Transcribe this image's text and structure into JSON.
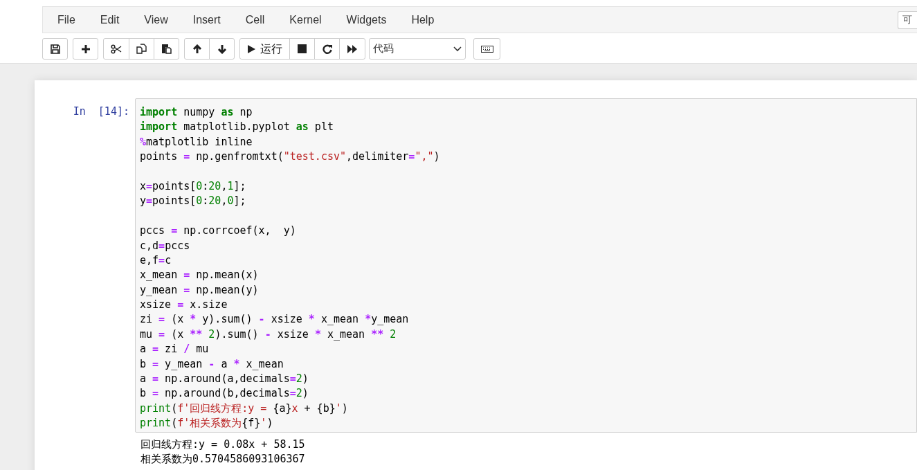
{
  "menu": [
    "File",
    "Edit",
    "View",
    "Insert",
    "Cell",
    "Kernel",
    "Widgets",
    "Help"
  ],
  "trusted_button": "可",
  "toolbar": {
    "groups": [
      [
        {
          "kind": "save"
        }
      ],
      [
        {
          "kind": "plus"
        }
      ],
      [
        {
          "kind": "cut"
        },
        {
          "kind": "copy"
        },
        {
          "kind": "paste"
        }
      ],
      [
        {
          "kind": "up"
        },
        {
          "kind": "down"
        }
      ],
      [
        {
          "kind": "run",
          "label": "运行"
        },
        {
          "kind": "stop"
        },
        {
          "kind": "restart"
        },
        {
          "kind": "ffwd"
        }
      ]
    ],
    "cell_type": "代码"
  },
  "cell": {
    "prompt": "In  [14]:",
    "code_blocks": [
      [
        [
          {
            "kind": "kw",
            "text": "import"
          },
          {
            "kind": "p",
            "text": " numpy "
          },
          {
            "kind": "kw",
            "text": "as"
          },
          {
            "kind": "p",
            "text": " np"
          }
        ],
        [
          {
            "kind": "kw",
            "text": "import"
          },
          {
            "kind": "p",
            "text": " matplotlib.pyplot "
          },
          {
            "kind": "kw",
            "text": "as"
          },
          {
            "kind": "p",
            "text": " plt"
          }
        ],
        [
          {
            "kind": "op",
            "text": "%"
          },
          {
            "kind": "p",
            "text": "matplotlib inline"
          }
        ],
        [
          {
            "kind": "p",
            "text": "points "
          },
          {
            "kind": "op",
            "text": "="
          },
          {
            "kind": "p",
            "text": " np.genfromtxt("
          },
          {
            "kind": "str",
            "text": "\"test.csv\""
          },
          {
            "kind": "p",
            "text": ",delimiter"
          },
          {
            "kind": "op",
            "text": "="
          },
          {
            "kind": "str",
            "text": "\",\""
          },
          {
            "kind": "p",
            "text": ")"
          }
        ]
      ],
      [
        [
          {
            "kind": "p",
            "text": "x"
          },
          {
            "kind": "op",
            "text": "="
          },
          {
            "kind": "p",
            "text": "points["
          },
          {
            "kind": "num",
            "text": "0"
          },
          {
            "kind": "p",
            "text": ":"
          },
          {
            "kind": "num",
            "text": "20"
          },
          {
            "kind": "p",
            "text": ","
          },
          {
            "kind": "num",
            "text": "1"
          },
          {
            "kind": "p",
            "text": "];"
          }
        ],
        [
          {
            "kind": "p",
            "text": "y"
          },
          {
            "kind": "op",
            "text": "="
          },
          {
            "kind": "p",
            "text": "points["
          },
          {
            "kind": "num",
            "text": "0"
          },
          {
            "kind": "p",
            "text": ":"
          },
          {
            "kind": "num",
            "text": "20"
          },
          {
            "kind": "p",
            "text": ","
          },
          {
            "kind": "num",
            "text": "0"
          },
          {
            "kind": "p",
            "text": "];"
          }
        ]
      ],
      [
        [
          {
            "kind": "p",
            "text": "pccs "
          },
          {
            "kind": "op",
            "text": "="
          },
          {
            "kind": "p",
            "text": " np.corrcoef(x,  y)"
          }
        ],
        [
          {
            "kind": "p",
            "text": "c,d"
          },
          {
            "kind": "op",
            "text": "="
          },
          {
            "kind": "p",
            "text": "pccs"
          }
        ],
        [
          {
            "kind": "p",
            "text": "e,f"
          },
          {
            "kind": "op",
            "text": "="
          },
          {
            "kind": "p",
            "text": "c"
          }
        ],
        [
          {
            "kind": "p",
            "text": "x_mean "
          },
          {
            "kind": "op",
            "text": "="
          },
          {
            "kind": "p",
            "text": " np.mean(x)"
          }
        ],
        [
          {
            "kind": "p",
            "text": "y_mean "
          },
          {
            "kind": "op",
            "text": "="
          },
          {
            "kind": "p",
            "text": " np.mean(y)"
          }
        ],
        [
          {
            "kind": "p",
            "text": "xsize "
          },
          {
            "kind": "op",
            "text": "="
          },
          {
            "kind": "p",
            "text": " x.size"
          }
        ],
        [
          {
            "kind": "p",
            "text": "zi "
          },
          {
            "kind": "op",
            "text": "="
          },
          {
            "kind": "p",
            "text": " (x "
          },
          {
            "kind": "op",
            "text": "*"
          },
          {
            "kind": "p",
            "text": " y).sum() "
          },
          {
            "kind": "op",
            "text": "-"
          },
          {
            "kind": "p",
            "text": " xsize "
          },
          {
            "kind": "op",
            "text": "*"
          },
          {
            "kind": "p",
            "text": " x_mean "
          },
          {
            "kind": "op",
            "text": "*"
          },
          {
            "kind": "p",
            "text": "y_mean"
          }
        ],
        [
          {
            "kind": "p",
            "text": "mu "
          },
          {
            "kind": "op",
            "text": "="
          },
          {
            "kind": "p",
            "text": " (x "
          },
          {
            "kind": "op",
            "text": "**"
          },
          {
            "kind": "num",
            "text": " 2"
          },
          {
            "kind": "p",
            "text": ").sum() "
          },
          {
            "kind": "op",
            "text": "-"
          },
          {
            "kind": "p",
            "text": " xsize "
          },
          {
            "kind": "op",
            "text": "*"
          },
          {
            "kind": "p",
            "text": " x_mean "
          },
          {
            "kind": "op",
            "text": "**"
          },
          {
            "kind": "num",
            "text": " 2"
          }
        ],
        [
          {
            "kind": "p",
            "text": "a "
          },
          {
            "kind": "op",
            "text": "="
          },
          {
            "kind": "p",
            "text": " zi "
          },
          {
            "kind": "op",
            "text": "/"
          },
          {
            "kind": "p",
            "text": " mu"
          }
        ],
        [
          {
            "kind": "p",
            "text": "b "
          },
          {
            "kind": "op",
            "text": "="
          },
          {
            "kind": "p",
            "text": " y_mean "
          },
          {
            "kind": "op",
            "text": "-"
          },
          {
            "kind": "p",
            "text": " a "
          },
          {
            "kind": "op",
            "text": "*"
          },
          {
            "kind": "p",
            "text": " x_mean"
          }
        ],
        [
          {
            "kind": "p",
            "text": "a "
          },
          {
            "kind": "op",
            "text": "="
          },
          {
            "kind": "p",
            "text": " np.around(a,decimals"
          },
          {
            "kind": "op",
            "text": "="
          },
          {
            "kind": "num",
            "text": "2"
          },
          {
            "kind": "p",
            "text": ")"
          }
        ],
        [
          {
            "kind": "p",
            "text": "b "
          },
          {
            "kind": "op",
            "text": "="
          },
          {
            "kind": "p",
            "text": " np.around(b,decimals"
          },
          {
            "kind": "op",
            "text": "="
          },
          {
            "kind": "num",
            "text": "2"
          },
          {
            "kind": "p",
            "text": ")"
          }
        ],
        [
          {
            "kind": "bi",
            "text": "print"
          },
          {
            "kind": "p",
            "text": "("
          },
          {
            "kind": "str",
            "text": "f'回归线方程:y = "
          },
          {
            "kind": "p",
            "text": "{a}"
          },
          {
            "kind": "str",
            "text": "x"
          },
          {
            "kind": "p",
            "text": " + {b}"
          },
          {
            "kind": "str",
            "text": "'"
          },
          {
            "kind": "p",
            "text": ")"
          }
        ],
        [
          {
            "kind": "bi",
            "text": "print"
          },
          {
            "kind": "p",
            "text": "("
          },
          {
            "kind": "str",
            "text": "f'相关系数为"
          },
          {
            "kind": "p",
            "text": "{f}"
          },
          {
            "kind": "str",
            "text": "'"
          },
          {
            "kind": "p",
            "text": ")"
          }
        ]
      ]
    ],
    "output": [
      "回归线方程:y = 0.08x + 58.15",
      "相关系数为0.5704586093106367"
    ]
  }
}
